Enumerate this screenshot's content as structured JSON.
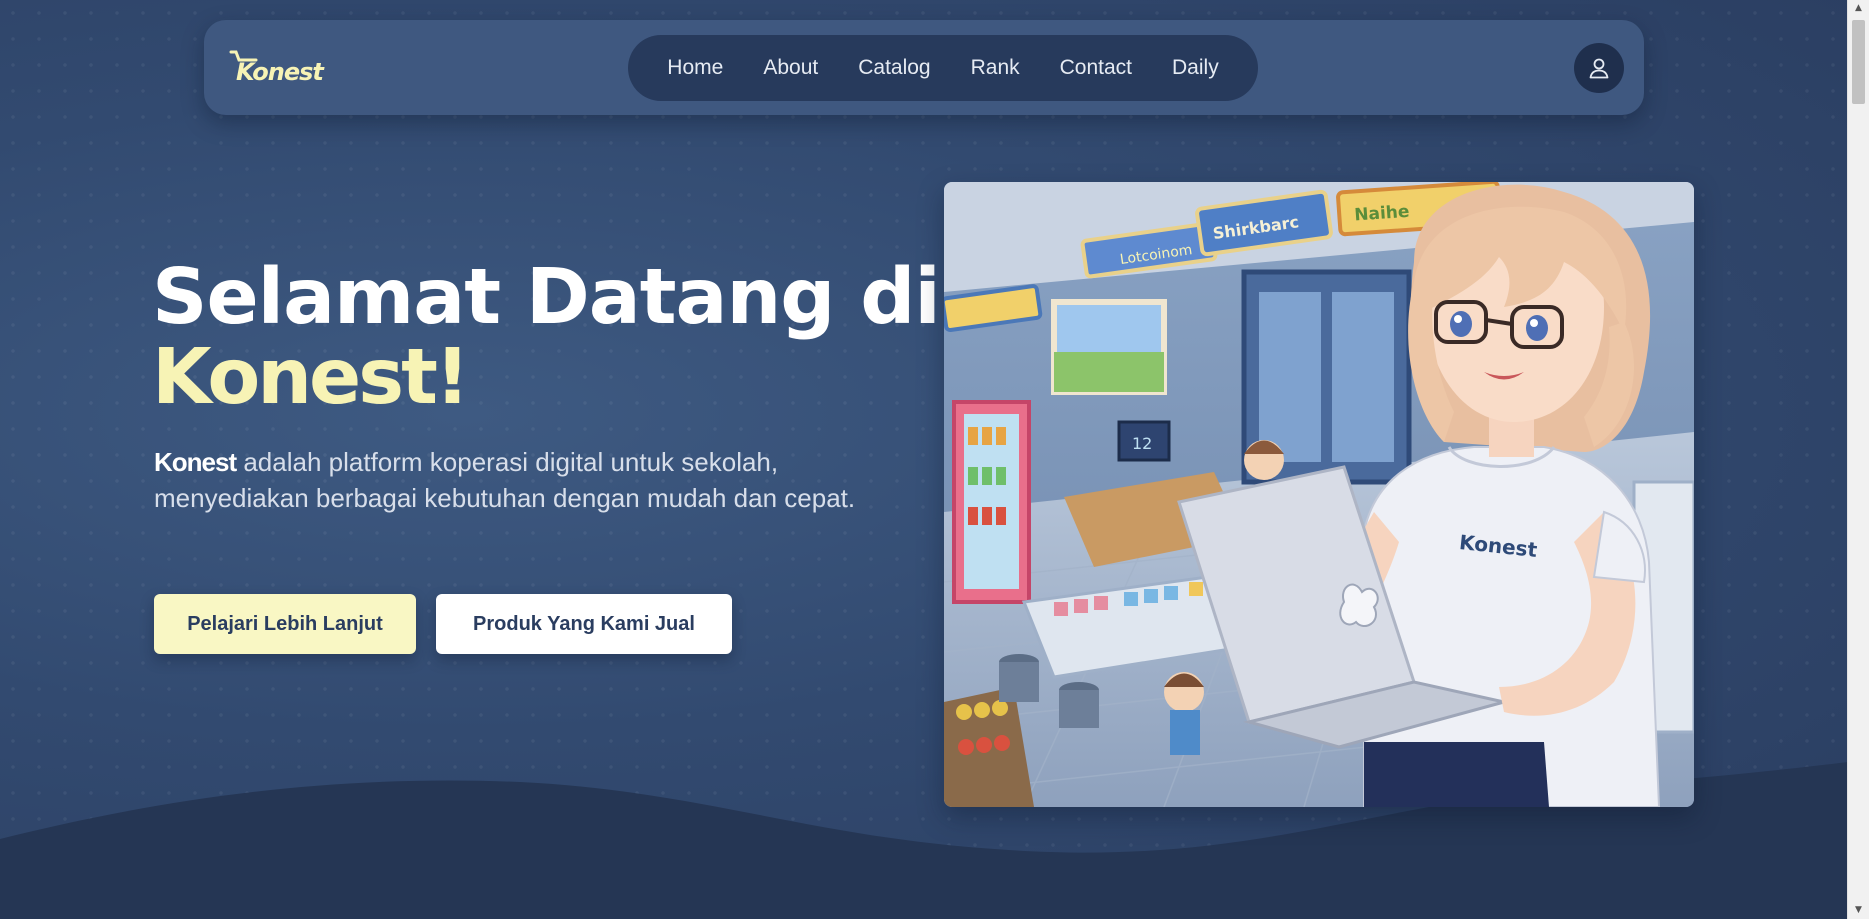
{
  "header": {
    "logo_text": "Konest",
    "nav": [
      {
        "label": "Home"
      },
      {
        "label": "About"
      },
      {
        "label": "Catalog"
      },
      {
        "label": "Rank"
      },
      {
        "label": "Contact"
      },
      {
        "label": "Daily"
      }
    ],
    "profile_icon": "user-icon"
  },
  "hero": {
    "title_line1": "Selamat Datang di",
    "title_brand": "Konest!",
    "desc_brand": "Konest",
    "desc_text": " adalah platform koperasi digital untuk sekolah, menyediakan berbagai kebutuhan dengan mudah dan cepat.",
    "primary_button": "Pelajari Lebih Lanjut",
    "secondary_button": "Produk Yang Kami Jual",
    "illustration": {
      "shirt_logo": "Konest",
      "store_signs": [
        "Shirkbarc",
        "Lotcoinom",
        "Naihe"
      ],
      "counter_display": "12"
    }
  },
  "colors": {
    "background": "#2e4266",
    "navbar": "#3f5880",
    "nav_pill": "#273a5c",
    "accent_yellow": "#f7f3b5",
    "button_primary": "#f9f7c4",
    "button_secondary": "#ffffff"
  }
}
